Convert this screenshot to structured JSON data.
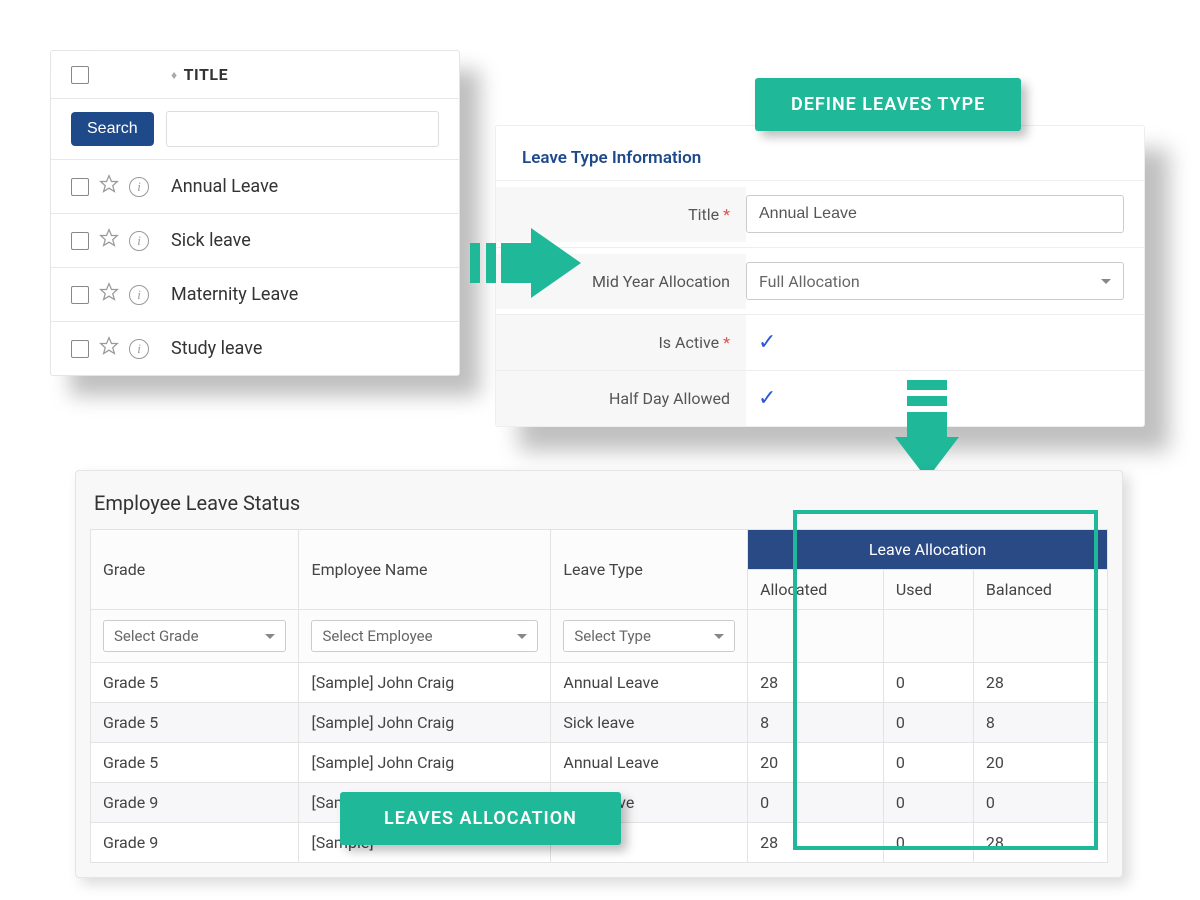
{
  "badges": {
    "define": "DEFINE LEAVES TYPE",
    "allocation": "LEAVES ALLOCATION"
  },
  "list_panel": {
    "header": {
      "title": "TITLE"
    },
    "search_button": "Search",
    "search_value": "",
    "items": [
      {
        "title": "Annual Leave"
      },
      {
        "title": "Sick leave"
      },
      {
        "title": "Maternity Leave"
      },
      {
        "title": "Study leave"
      }
    ]
  },
  "info_panel": {
    "heading": "Leave Type Information",
    "fields": {
      "title_label": "Title",
      "title_value": "Annual Leave",
      "midyear_label": "Mid Year Allocation",
      "midyear_value": "Full Allocation",
      "active_label": "Is Active",
      "active_checked": "✓",
      "halfday_label": "Half Day Allowed",
      "halfday_checked": "✓"
    }
  },
  "status_panel": {
    "heading": "Employee Leave Status",
    "columns": {
      "grade": "Grade",
      "employee": "Employee Name",
      "leave_type": "Leave Type",
      "alloc_group": "Leave Allocation",
      "allocated": "Allocated",
      "used": "Used",
      "balanced": "Balanced"
    },
    "filters": {
      "grade": "Select Grade",
      "employee": "Select Employee",
      "type": "Select Type"
    },
    "rows": [
      {
        "grade": "Grade 5",
        "employee": "[Sample] John Craig",
        "type": "Annual Leave",
        "allocated": "28",
        "used": "0",
        "balanced": "28"
      },
      {
        "grade": "Grade 5",
        "employee": "[Sample] John Craig",
        "type": "Sick leave",
        "allocated": "8",
        "used": "0",
        "balanced": "8"
      },
      {
        "grade": "Grade 5",
        "employee": "[Sample] John Craig",
        "type": "Annual Leave",
        "allocated": "20",
        "used": "0",
        "balanced": "20"
      },
      {
        "grade": "Grade 9",
        "employee": "[Sample] Kayla Doris",
        "type": "Sick leave",
        "allocated": "0",
        "used": "0",
        "balanced": "0"
      },
      {
        "grade": "Grade 9",
        "employee": "[Sample]",
        "type": "",
        "allocated": "28",
        "used": "0",
        "balanced": "28"
      }
    ]
  }
}
